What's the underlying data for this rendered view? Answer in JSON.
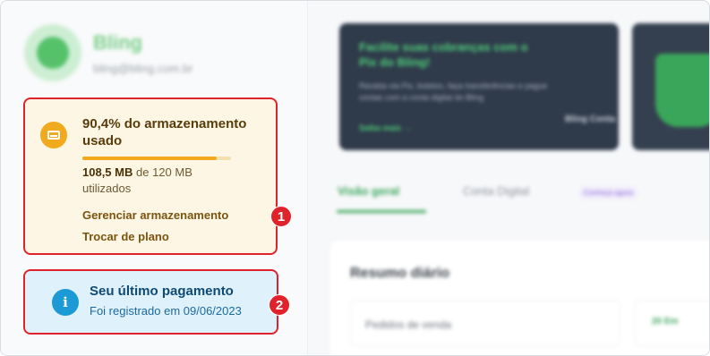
{
  "user": {
    "name": "Bling",
    "email": "bling@bling.com.br"
  },
  "storage": {
    "title": "90,4% do armazenamento usado",
    "used_fraction": 0.904,
    "used_value": "108,5 MB",
    "total_text": "de 120 MB",
    "suffix": "utilizados",
    "manage_link": "Gerenciar armazenamento",
    "change_plan_link": "Trocar de plano",
    "icon": "hard-drive-icon",
    "accent_color": "#f1a91d"
  },
  "payment": {
    "title": "Seu último pagamento",
    "subtitle": "Foi registrado em 09/06/2023",
    "icon": "info-icon",
    "accent_color": "#1c9ad6"
  },
  "annotations": {
    "badge_1": "1",
    "badge_2": "2",
    "color": "#e0222b"
  },
  "background": {
    "banner_title": "Facilite suas cobranças com o Pix do Bling!",
    "banner_text": "Receba via Pix, boletos, faça transferências e pague contas com a conta digital do Bling",
    "banner_link": "Saiba mais →",
    "banner_brand": "Bling Conta",
    "tabs": [
      "Visão geral",
      "Conta Digital"
    ],
    "tab_badge": "Conheça agora",
    "panel_title": "Resumo diário",
    "panel_row": "Pedidos de venda",
    "panel_row_value": "20 Em"
  }
}
